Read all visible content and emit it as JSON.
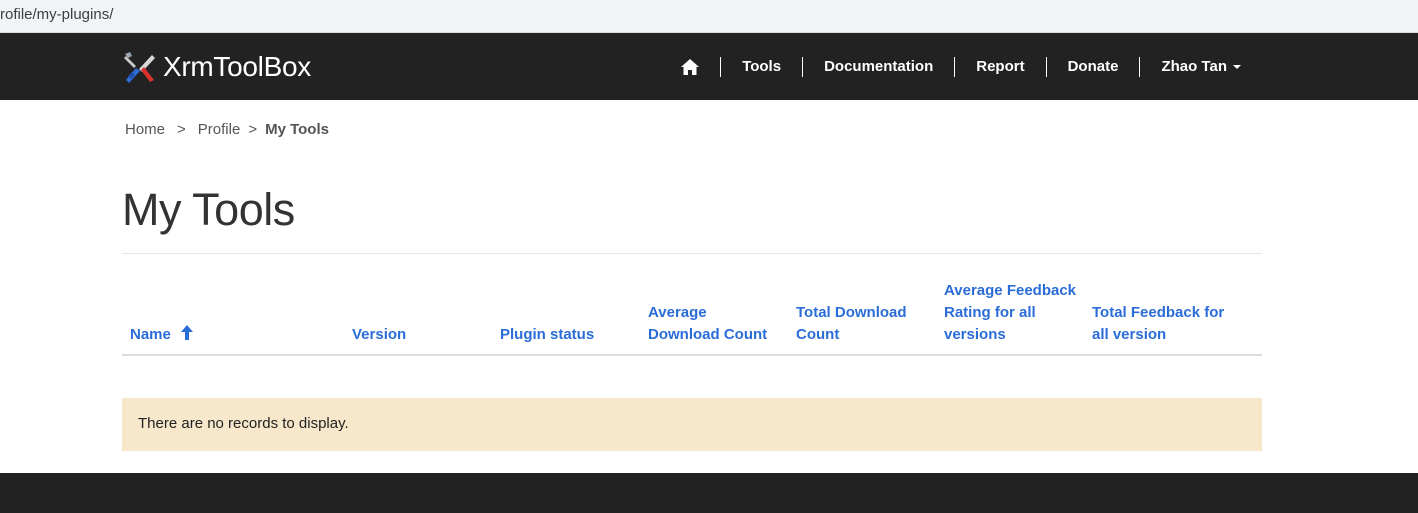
{
  "browser": {
    "url": "rofile/my-plugins/"
  },
  "brand": {
    "name": "XrmToolBox"
  },
  "nav": {
    "home_icon": "home-icon",
    "items": [
      {
        "label": "Tools"
      },
      {
        "label": "Documentation"
      },
      {
        "label": "Report"
      },
      {
        "label": "Donate"
      }
    ],
    "user": {
      "label": "Zhao Tan"
    }
  },
  "breadcrumb": {
    "home": "Home",
    "separator": ">",
    "profile": "Profile",
    "current": "My Tools"
  },
  "page": {
    "title": "My Tools"
  },
  "table": {
    "columns": [
      {
        "label": "Name",
        "sort": "ascending"
      },
      {
        "label": "Version"
      },
      {
        "label": "Plugin status"
      },
      {
        "label": "Average Download Count"
      },
      {
        "label": "Total Download Count"
      },
      {
        "label": "Average Feedback Rating for all versions"
      },
      {
        "label": "Total Feedback for all version"
      }
    ],
    "rows": [],
    "empty_message": "There are no records to display."
  },
  "colors": {
    "navbar": "#222222",
    "link": "#2a6dd8",
    "empty_bg": "#f8e8cb"
  }
}
